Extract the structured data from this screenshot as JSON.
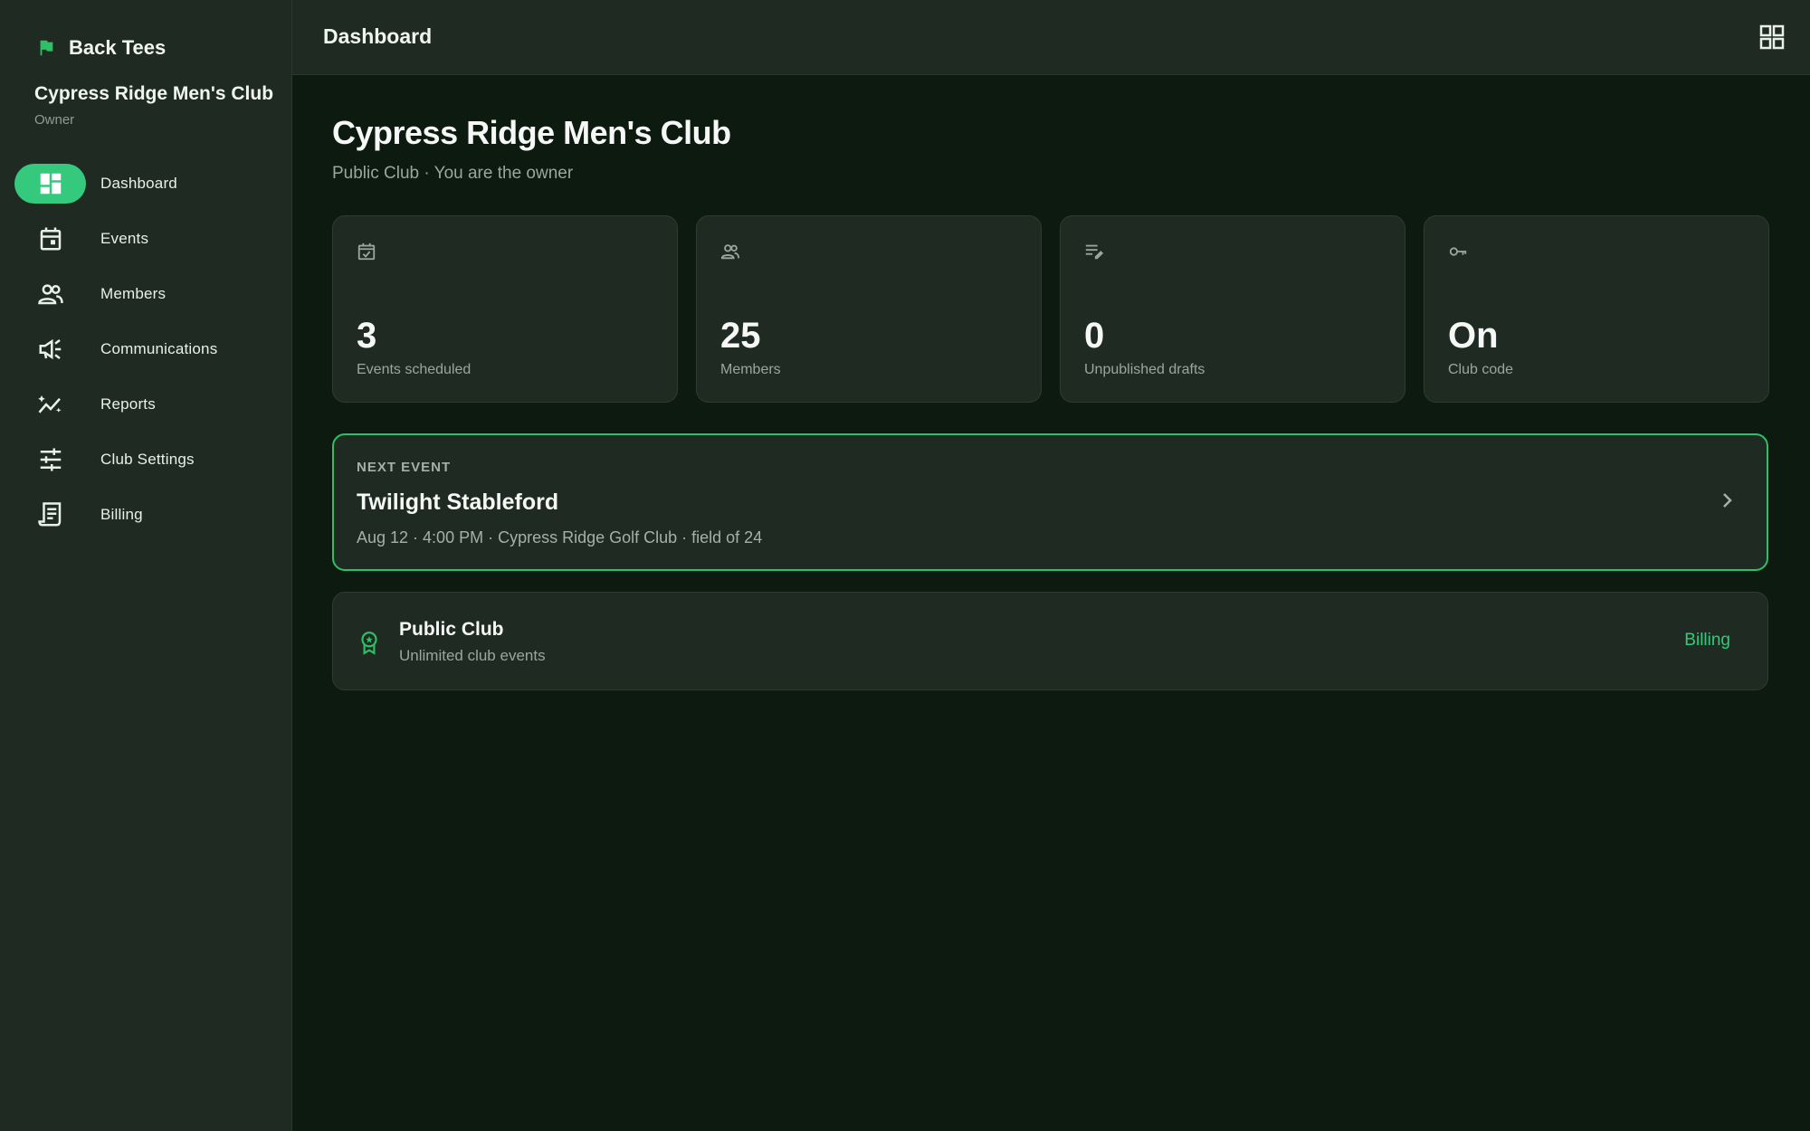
{
  "brand": {
    "name": "Back Tees"
  },
  "club": {
    "name": "Cypress Ridge Men's Club",
    "role": "Owner"
  },
  "nav": {
    "items": [
      {
        "label": "Dashboard",
        "icon": "dashboard-icon",
        "active": true
      },
      {
        "label": "Events",
        "icon": "calendar-icon"
      },
      {
        "label": "Members",
        "icon": "people-icon"
      },
      {
        "label": "Communications",
        "icon": "megaphone-icon"
      },
      {
        "label": "Reports",
        "icon": "trending-icon"
      },
      {
        "label": "Club Settings",
        "icon": "tune-icon"
      },
      {
        "label": "Billing",
        "icon": "receipt-icon"
      }
    ]
  },
  "topbar": {
    "title": "Dashboard"
  },
  "page": {
    "title": "Cypress Ridge Men's Club",
    "subtitle": "Public Club · You are the owner"
  },
  "stats": [
    {
      "value": "3",
      "label": "Events scheduled",
      "icon": "event-check-icon"
    },
    {
      "value": "25",
      "label": "Members",
      "icon": "people-icon"
    },
    {
      "value": "0",
      "label": "Unpublished drafts",
      "icon": "edit-note-icon"
    },
    {
      "value": "On",
      "label": "Club code",
      "icon": "key-icon"
    }
  ],
  "next_event": {
    "kicker": "NEXT EVENT",
    "title": "Twilight Stableford",
    "meta": "Aug 12 · 4:00 PM · Cypress Ridge Golf Club · field of 24"
  },
  "plan": {
    "name": "Public Club",
    "description": "Unlimited club events",
    "link": "Billing"
  },
  "colors": {
    "accent": "#34c97c",
    "sidebar_bg": "#1f2b22",
    "page_bg": "#0d1a10",
    "card_border_highlight": "#2fbf67"
  }
}
